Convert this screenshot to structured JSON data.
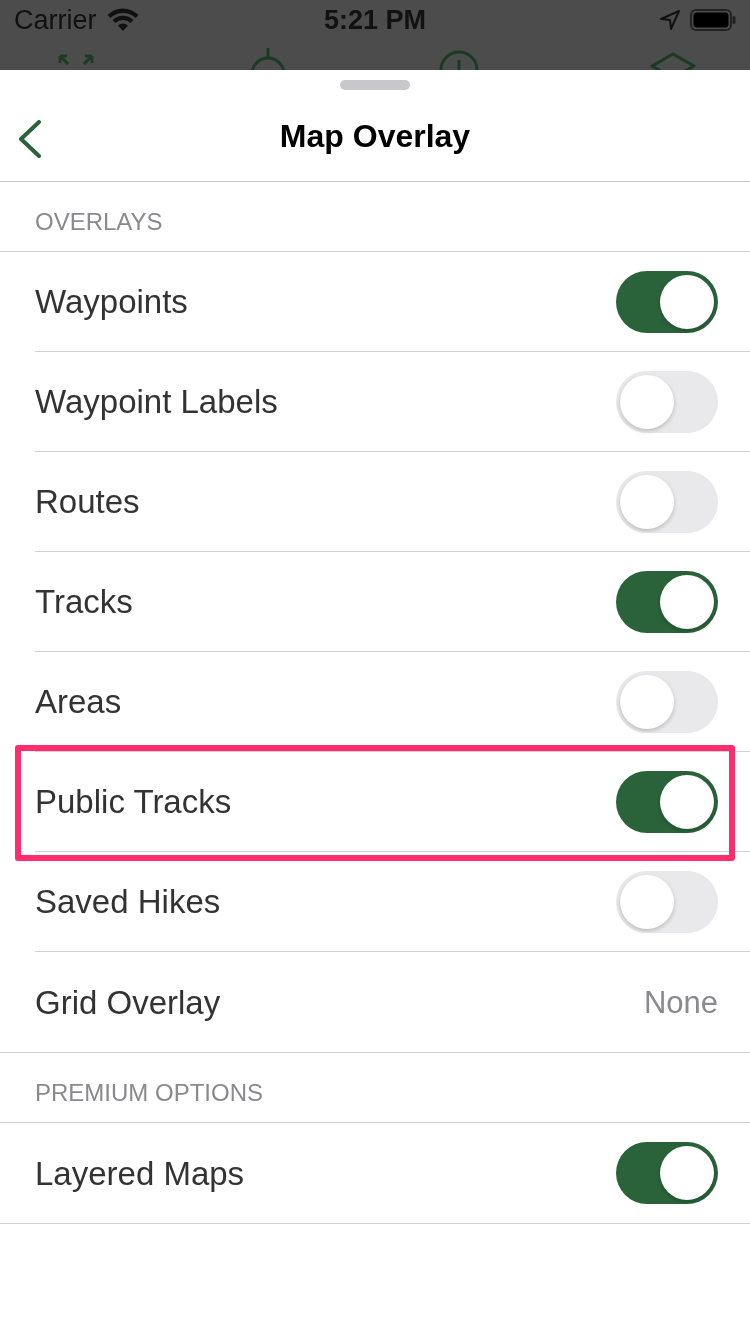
{
  "status_bar": {
    "carrier": "Carrier",
    "time": "5:21 PM"
  },
  "sheet": {
    "title": "Map Overlay"
  },
  "sections": [
    {
      "header": "OVERLAYS",
      "rows": [
        {
          "label": "Waypoints",
          "kind": "toggle",
          "on": true,
          "highlighted": false
        },
        {
          "label": "Waypoint Labels",
          "kind": "toggle",
          "on": false,
          "highlighted": false
        },
        {
          "label": "Routes",
          "kind": "toggle",
          "on": false,
          "highlighted": false
        },
        {
          "label": "Tracks",
          "kind": "toggle",
          "on": true,
          "highlighted": false
        },
        {
          "label": "Areas",
          "kind": "toggle",
          "on": false,
          "highlighted": false
        },
        {
          "label": "Public Tracks",
          "kind": "toggle",
          "on": true,
          "highlighted": true
        },
        {
          "label": "Saved Hikes",
          "kind": "toggle",
          "on": false,
          "highlighted": false
        },
        {
          "label": "Grid Overlay",
          "kind": "value",
          "value": "None",
          "highlighted": false
        }
      ]
    },
    {
      "header": "PREMIUM OPTIONS",
      "rows": [
        {
          "label": "Layered Maps",
          "kind": "toggle",
          "on": true,
          "highlighted": false
        }
      ]
    }
  ]
}
